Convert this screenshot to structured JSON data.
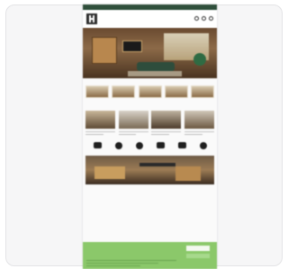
{
  "topbar": {
    "text": ""
  },
  "hero": {
    "badge": ""
  },
  "sections": {
    "categories_title": "",
    "products_title": ""
  },
  "categories": [
    "",
    "",
    "",
    "",
    ""
  ],
  "products": [
    {
      "name": "",
      "price": ""
    },
    {
      "name": "",
      "price": ""
    },
    {
      "name": "",
      "price": ""
    },
    {
      "name": "",
      "price": ""
    }
  ],
  "features": [
    "",
    "",
    "",
    "",
    "",
    ""
  ],
  "cookie": {
    "text": "",
    "accept_label": "",
    "settings_label": ""
  },
  "colors": {
    "topbar": "#2f4f3b",
    "cookie_banner": "#8bc86a",
    "badge": "#2f6b43"
  }
}
